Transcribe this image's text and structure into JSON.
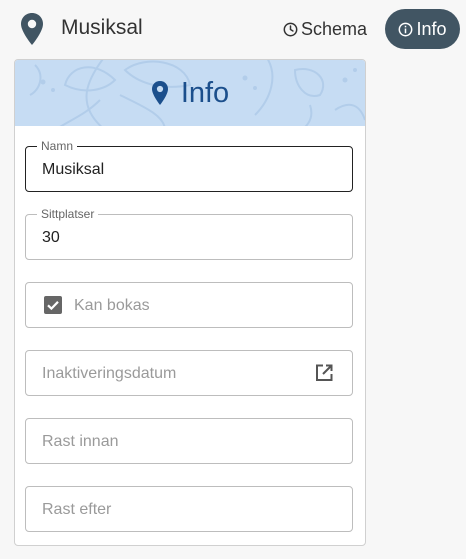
{
  "header": {
    "room_title": "Musiksal",
    "room_icon": "location-pin-icon",
    "tabs": [
      {
        "label": "Schema",
        "icon": "clock-icon",
        "active": false
      },
      {
        "label": "Info",
        "icon": "info-icon",
        "active": true
      }
    ]
  },
  "card": {
    "title": "Info",
    "title_icon": "location-pin-icon",
    "header_color": "#c6dcf3",
    "fields": {
      "namn": {
        "label": "Namn",
        "value": "Musiksal"
      },
      "sittplatser": {
        "label": "Sittplatser",
        "value": "30"
      },
      "kan_bokas": {
        "label": "Kan bokas",
        "checked": true
      },
      "inaktiveringsdatum": {
        "placeholder": "Inaktiveringsdatum",
        "icon": "open-in-new-icon"
      },
      "rast_innan": {
        "placeholder": "Rast innan"
      },
      "rast_efter": {
        "placeholder": "Rast efter"
      }
    }
  },
  "colors": {
    "accent_dark": "#415563",
    "title_blue": "#1b4f8c",
    "pin_gray": "#415563"
  }
}
